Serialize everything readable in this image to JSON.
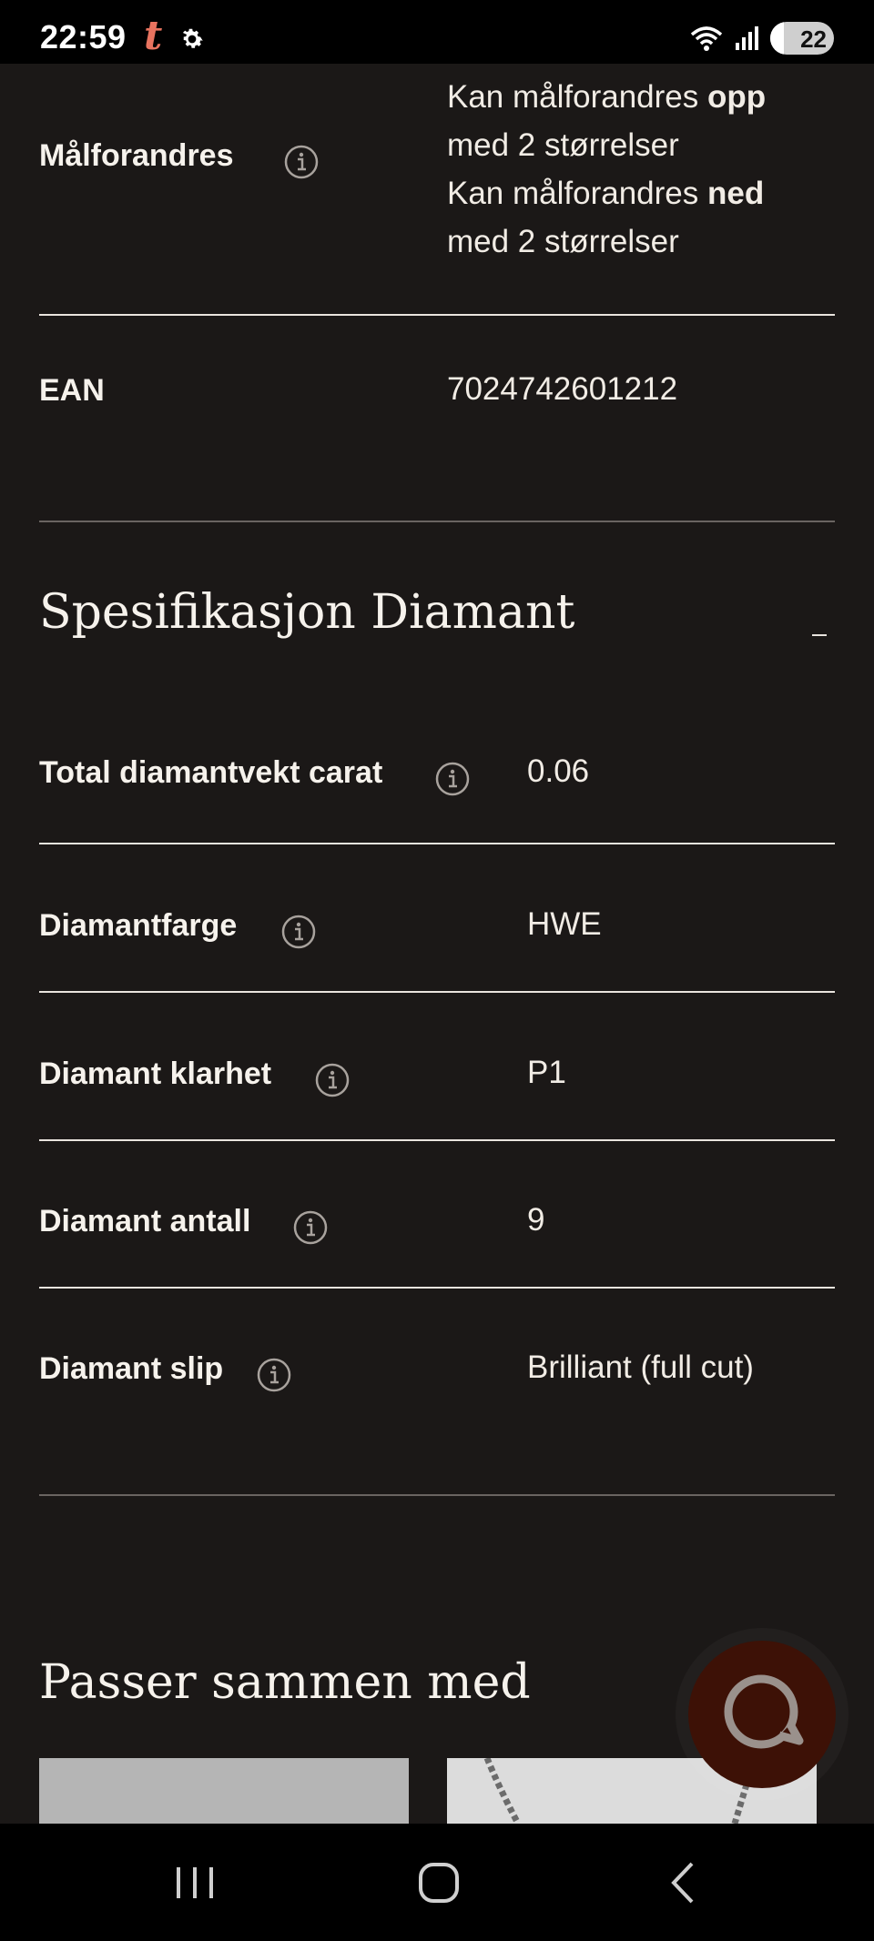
{
  "status_bar": {
    "time": "22:59",
    "app_badge": "t",
    "battery": "22",
    "battery_level": 0.22
  },
  "specs_top": {
    "resize_label": "Målforandres",
    "resize_lines": [
      {
        "prefix": "Kan målforandres ",
        "strong": "opp"
      },
      {
        "prefix": "med 2 størrelser",
        "strong": ""
      },
      {
        "prefix": "Kan målforandres ",
        "strong": "ned"
      },
      {
        "prefix": "med 2 størrelser",
        "strong": ""
      }
    ],
    "ean_label": "EAN",
    "ean_value": "7024742601212"
  },
  "diamond_section": {
    "title": "Spesifikasjon Diamant",
    "collapse_symbol": "–",
    "rows": [
      {
        "label": "Total diamantvekt carat",
        "value": "0.06"
      },
      {
        "label": "Diamantfarge",
        "value": "HWE"
      },
      {
        "label": "Diamant klarhet",
        "value": "P1"
      },
      {
        "label": "Diamant antall",
        "value": "9"
      },
      {
        "label": "Diamant slip",
        "value": "Brilliant (full cut)"
      }
    ]
  },
  "related": {
    "title": "Passer sammen med"
  },
  "colors": {
    "background": "#1b1817",
    "text": "#f3efe9",
    "chat_button": "#3d1106",
    "card": "#b3b3b3"
  },
  "icons": {
    "info": "info-circle-icon",
    "chat": "chat-bubble-icon",
    "settings": "gear-icon"
  }
}
